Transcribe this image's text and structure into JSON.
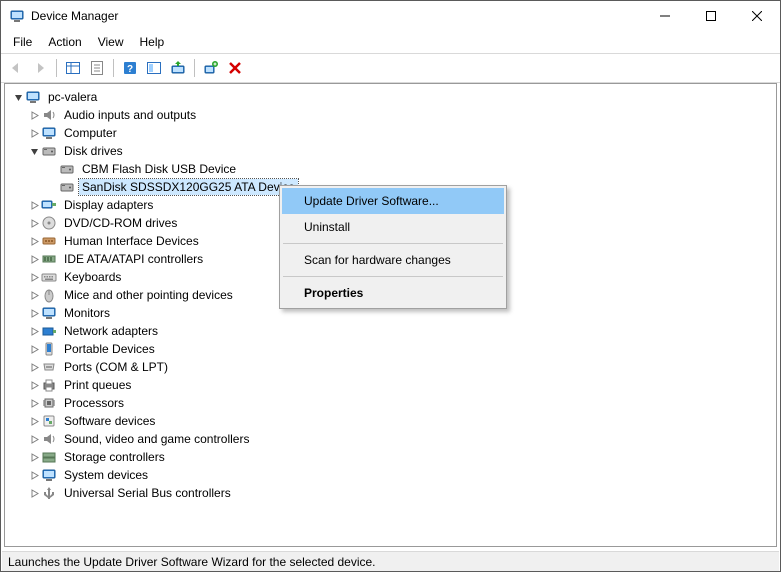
{
  "window": {
    "title": "Device Manager"
  },
  "menu": {
    "file": "File",
    "action": "Action",
    "view": "View",
    "help": "Help"
  },
  "tree": {
    "root": "pc-valera",
    "categories": {
      "audio": "Audio inputs and outputs",
      "computer": "Computer",
      "disk": "Disk drives",
      "display": "Display adapters",
      "dvd": "DVD/CD-ROM drives",
      "hid": "Human Interface Devices",
      "ide": "IDE ATA/ATAPI controllers",
      "keyboards": "Keyboards",
      "mice": "Mice and other pointing devices",
      "monitors": "Monitors",
      "network": "Network adapters",
      "portable": "Portable Devices",
      "ports": "Ports (COM & LPT)",
      "print": "Print queues",
      "processors": "Processors",
      "software": "Software devices",
      "sound": "Sound, video and game controllers",
      "storage": "Storage controllers",
      "system": "System devices",
      "usb": "Universal Serial Bus controllers"
    },
    "disk_children": {
      "cbm": "CBM Flash Disk USB Device",
      "sandisk": "SanDisk SDSSDX120GG25 ATA Device"
    }
  },
  "context_menu": {
    "update": "Update Driver Software...",
    "uninstall": "Uninstall",
    "scan": "Scan for hardware changes",
    "properties": "Properties"
  },
  "status": {
    "text": "Launches the Update Driver Software Wizard for the selected device."
  }
}
